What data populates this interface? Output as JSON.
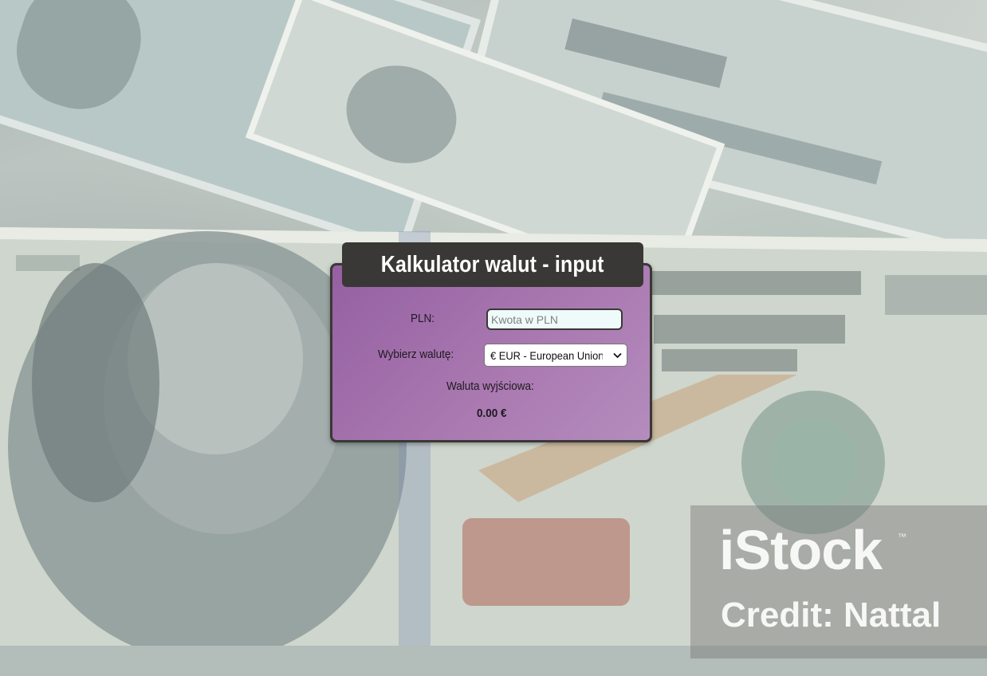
{
  "calculator": {
    "title": "Kalkulator walut - input",
    "pln_label": "PLN:",
    "pln_input_value": "",
    "pln_input_placeholder": "Kwota w PLN",
    "currency_label": "Wybierz walutę:",
    "currency_selected": "€ EUR - European Union",
    "output_label": "Waluta wyjściowa:",
    "output_value": "0.00 €"
  },
  "background": {
    "description_icon": "banknotes-background",
    "watermark_logo": "iStock",
    "watermark_tm": "™",
    "watermark_credit": "Credit: Nattal"
  },
  "colors": {
    "card_gradient_start": "#9560a2",
    "card_gradient_end": "#b48cbd",
    "header_bg": "#3a3836",
    "input_bg": "#eefbfa"
  }
}
